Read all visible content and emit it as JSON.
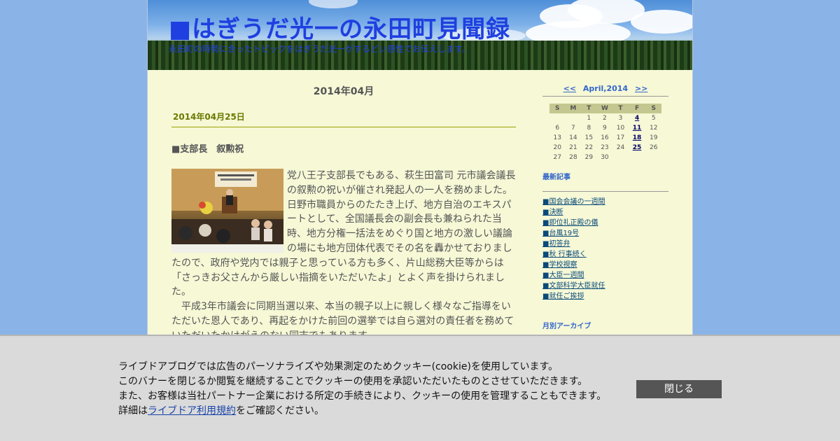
{
  "header": {
    "title": "■はぎうだ光一の永田町見聞録",
    "description": "永田町の時勢に合ったトピックをはぎうだ光一がするどい感性でお伝えします。"
  },
  "main": {
    "month_heading": "2014年04月",
    "date_heading": "2014年04月25日",
    "entry_title": "■支部長　叙勲祝",
    "paragraph1": "党八王子支部長でもある、萩生田富司 元市議会議長の叙勲の祝いが催され発起人の一人を務めました。日野市職員からのたたき上げ、地方自治のエキスパートとして、全国議長会の副会長も兼ねられた当時、地方分権一括法をめぐり国と地方の激しい議論の場にも地方団体代表でその名を轟かせておりましたので、政府や党内では親子と思っている方も多く、片山総務大臣等からは「さっきお父さんから厳しい指摘をいただいたよ」とよく声を掛けられました。",
    "paragraph2": "　平成3年市議会に同期当選以来、本当の親子以上に親しく様々なご指導をいただいた恩人であり、再起をかけた前回の選挙では自ら選対の責任者を務めていただいたかけがえのない同志でもあります。"
  },
  "sidebar": {
    "calendar": {
      "prev": "<<",
      "title": "April,2014",
      "next": ">>",
      "weekdays": [
        "S",
        "M",
        "T",
        "W",
        "T",
        "F",
        "S"
      ],
      "weeks": [
        [
          "",
          "",
          "1",
          "2",
          "3",
          "4",
          "5"
        ],
        [
          "6",
          "7",
          "8",
          "9",
          "10",
          "11",
          "12"
        ],
        [
          "13",
          "14",
          "15",
          "16",
          "17",
          "18",
          "19"
        ],
        [
          "20",
          "21",
          "22",
          "23",
          "24",
          "25",
          "26"
        ],
        [
          "27",
          "28",
          "29",
          "30",
          "",
          "",
          ""
        ]
      ],
      "linked_days": [
        "4",
        "11",
        "18",
        "25"
      ]
    },
    "recent_heading": "最新記事",
    "recent": [
      "■国会会議の一週間",
      "■決断",
      "■即位礼正殿の儀",
      "■台風19号",
      "■初答弁",
      "■秋 行事続く",
      "■学校視察",
      "■大臣一週間",
      "■文部科学大臣就任",
      "■就任ご挨拶"
    ],
    "archive_heading": "月別アーカイブ"
  },
  "cookie": {
    "line1": "ライブドアブログでは広告のパーソナライズや効果測定のためクッキー(cookie)を使用しています。",
    "line2": "このバナーを閉じるか閲覧を継続することでクッキーの使用を承認いただいたものとさせていただきます。",
    "line3": "また、お客様は当社パートナー企業における所定の手続きにより、クッキーの使用を管理することもできます。",
    "line4_prefix": "詳細は",
    "line4_link": "ライブドア利用規約",
    "line4_suffix": "をご確認ください。",
    "close_label": "閉じる"
  }
}
